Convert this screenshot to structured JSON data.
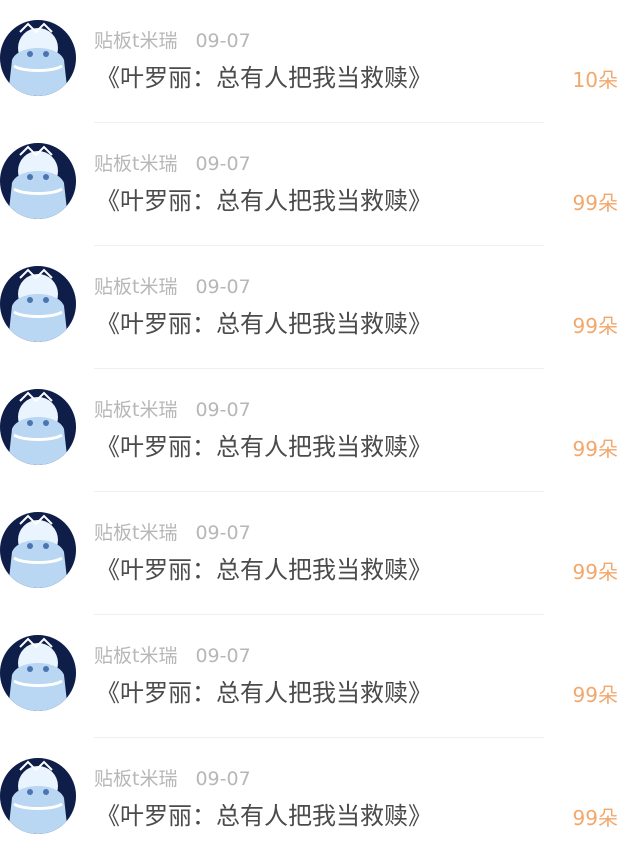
{
  "items": [
    {
      "user": "贴板t米瑞",
      "date": "09-07",
      "title": "《叶罗丽：总有人把我当救赎》",
      "gift": "10朵"
    },
    {
      "user": "贴板t米瑞",
      "date": "09-07",
      "title": "《叶罗丽：总有人把我当救赎》",
      "gift": "99朵"
    },
    {
      "user": "贴板t米瑞",
      "date": "09-07",
      "title": "《叶罗丽：总有人把我当救赎》",
      "gift": "99朵"
    },
    {
      "user": "贴板t米瑞",
      "date": "09-07",
      "title": "《叶罗丽：总有人把我当救赎》",
      "gift": "99朵"
    },
    {
      "user": "贴板t米瑞",
      "date": "09-07",
      "title": "《叶罗丽：总有人把我当救赎》",
      "gift": "99朵"
    },
    {
      "user": "贴板t米瑞",
      "date": "09-07",
      "title": "《叶罗丽：总有人把我当救赎》",
      "gift": "99朵"
    },
    {
      "user": "贴板t米瑞",
      "date": "09-07",
      "title": "《叶罗丽：总有人把我当救赎》",
      "gift": "99朵"
    }
  ],
  "colors": {
    "gift_accent": "#f2a76b",
    "meta_text": "#b7b7b7",
    "title_text": "#4b4b4b"
  }
}
